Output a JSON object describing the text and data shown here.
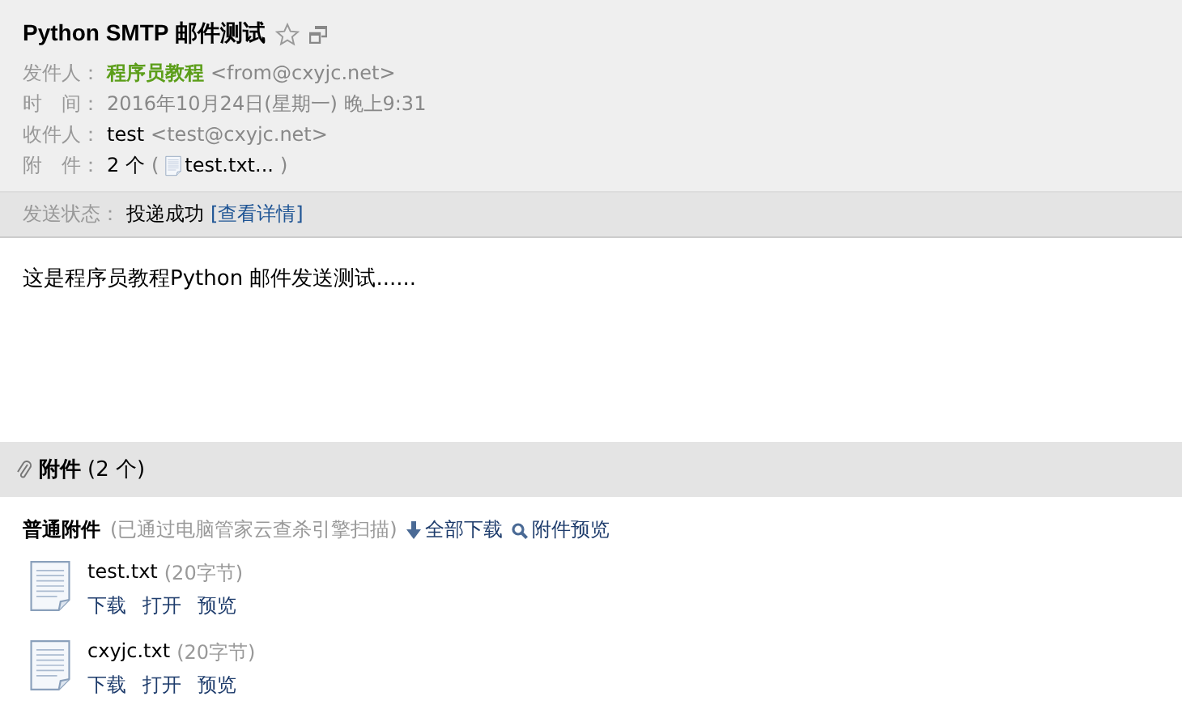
{
  "subject": "Python SMTP 邮件测试",
  "fields": [
    {
      "kind": "sender",
      "label": "发件人：",
      "name": "程序员教程",
      "value": "<from@cxyjc.net>"
    },
    {
      "kind": "text",
      "label": "时　间：",
      "value": "2016年10月24日(星期一) 晚上9:31"
    },
    {
      "kind": "recipient",
      "label": "收件人：",
      "name": "test",
      "value": "<test@cxyjc.net>"
    },
    {
      "kind": "attachments",
      "label": "附　件：",
      "count": "2 个",
      "open": "(",
      "link": "test.txt...",
      "close": ")"
    }
  ],
  "status": {
    "label": "发送状态：",
    "value": "投递成功",
    "link": "[查看详情]"
  },
  "body": "这是程序员教程Python 邮件发送测试......",
  "attachments": {
    "title": "附件",
    "count": "(2 个)",
    "section_title": "普通附件",
    "scan_note": "(已通过电脑管家云查杀引擎扫描)",
    "download_all": "全部下载",
    "preview_all": "附件预览",
    "files": [
      {
        "name": "test.txt",
        "size": "(20字节)",
        "actions": [
          "下载",
          "打开",
          "预览"
        ]
      },
      {
        "name": "cxyjc.txt",
        "size": "(20字节)",
        "actions": [
          "下载",
          "打开",
          "预览"
        ]
      }
    ]
  }
}
